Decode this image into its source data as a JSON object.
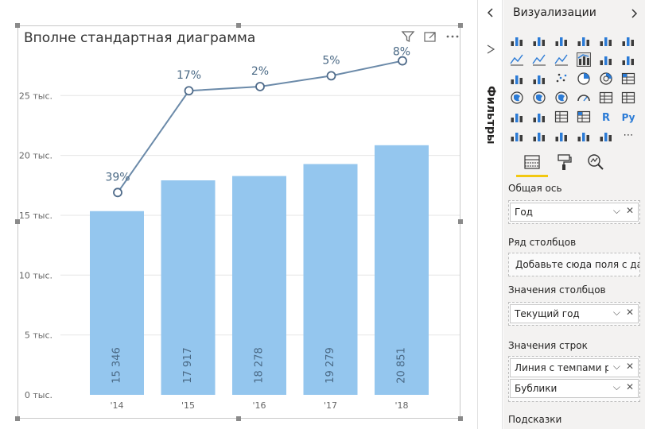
{
  "visual": {
    "title": "Вполне стандартная диаграмма",
    "header_icons": [
      "filter-icon",
      "focus-mode-icon",
      "more-options-icon"
    ]
  },
  "chart_data": {
    "type": "bar",
    "categories": [
      "'14",
      "'15",
      "'16",
      "'17",
      "'18"
    ],
    "series": [
      {
        "values": [
          15346,
          17917,
          18278,
          19279,
          20851
        ],
        "labels": [
          "15 346",
          "17 917",
          "18 278",
          "19 279",
          "20 851"
        ],
        "color": "#94c6ee"
      },
      {
        "line_labels": [
          "39%",
          "17%",
          "2%",
          "5%",
          "8%"
        ],
        "line_values": [
          16900,
          25400,
          25750,
          26650,
          27900
        ],
        "color": "#6b8aa9"
      }
    ],
    "yticks": [
      0,
      5000,
      10000,
      15000,
      20000,
      25000
    ],
    "ytick_labels": [
      "0 тыс.",
      "5 тыс.",
      "10 тыс.",
      "15 тыс.",
      "20 тыс.",
      "25 тыс."
    ],
    "ylim": [
      0,
      29000
    ],
    "grid": true
  },
  "filters": {
    "label": "Фильтры"
  },
  "viz_pane": {
    "title": "Визуализации",
    "gallery_more": "⋯",
    "sections": {
      "axis": {
        "label": "Общая ось",
        "value": "Год"
      },
      "column_series": {
        "label": "Ряд столбцов",
        "placeholder": "Добавьте сюда поля с дан..."
      },
      "column_values": {
        "label": "Значения столбцов",
        "value": "Текущий год"
      },
      "line_values": {
        "label": "Значения строк",
        "value1": "Линия с темпами роста",
        "value2": "Бублики"
      },
      "tooltips": {
        "label": "Подсказки"
      }
    },
    "icons": {
      "r_label": "R",
      "py_label": "Py"
    }
  }
}
